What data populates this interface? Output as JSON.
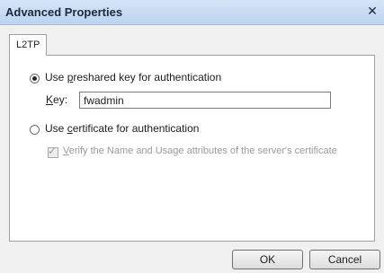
{
  "window": {
    "title": "Advanced Properties",
    "close_glyph": "✕"
  },
  "tabs": [
    {
      "label": "L2TP",
      "selected": true
    }
  ],
  "auth": {
    "preshared_label_pre": "Use ",
    "preshared_label_ul": "p",
    "preshared_label_post": "reshared key for authentication",
    "preshared_selected": true,
    "key_label_ul": "K",
    "key_label_post": "ey:",
    "key_value": "fwadmin",
    "certificate_label_pre": "Use ",
    "certificate_label_ul": "c",
    "certificate_label_post": "ertificate for authentication",
    "certificate_selected": false,
    "verify_label_ul": "V",
    "verify_label_post": "erify the Name and Usage attributes of the server's certificate",
    "verify_checked": true,
    "verify_enabled": false
  },
  "buttons": {
    "ok": "OK",
    "cancel": "Cancel"
  },
  "icons": {
    "close": "close-icon",
    "check": "checkmark-icon"
  }
}
